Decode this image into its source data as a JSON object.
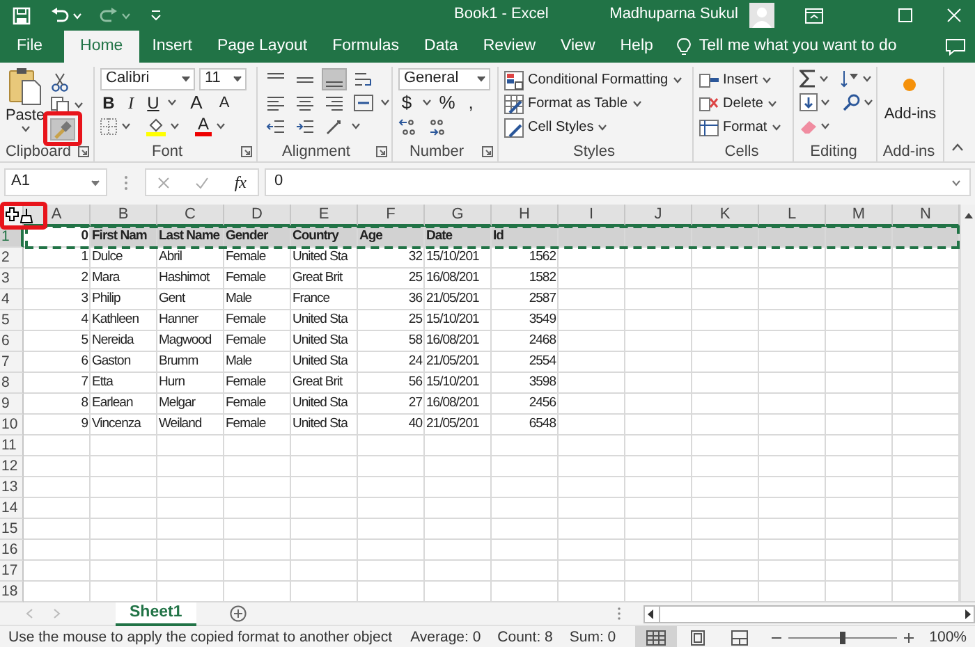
{
  "title_bar": {
    "title": "Book1 - Excel",
    "user": "Madhuparna Sukul"
  },
  "ribbon_tabs": [
    {
      "label": "File",
      "selected": false
    },
    {
      "label": "Home",
      "selected": true
    },
    {
      "label": "Insert",
      "selected": false
    },
    {
      "label": "Page Layout",
      "selected": false
    },
    {
      "label": "Formulas",
      "selected": false
    },
    {
      "label": "Data",
      "selected": false
    },
    {
      "label": "Review",
      "selected": false
    },
    {
      "label": "View",
      "selected": false
    },
    {
      "label": "Help",
      "selected": false
    }
  ],
  "tell_me": "Tell me what you want to do",
  "ribbon_groups": [
    {
      "kind": "clipboard",
      "label": "Clipboard",
      "paste": "Paste",
      "format_painter": {
        "pressed": true,
        "highlighted": true
      }
    },
    {
      "kind": "font",
      "label": "Font",
      "font": "Calibri",
      "size": "11",
      "style_buttons": [
        {
          "kind": "bold",
          "label": "B"
        },
        {
          "kind": "italic",
          "label": "I"
        },
        {
          "kind": "underline",
          "label": "U"
        }
      ],
      "size_buttons": [
        {
          "kind": "grow",
          "label": "A"
        },
        {
          "kind": "shrink",
          "label": "A"
        }
      ],
      "font_color_label": "A"
    },
    {
      "kind": "alignment",
      "label": "Alignment",
      "bottom_align": {
        "pressed": true
      }
    },
    {
      "kind": "number",
      "label": "Number",
      "format": "General",
      "symbols": [
        "$",
        "%",
        ","
      ]
    },
    {
      "kind": "styles",
      "label": "Styles",
      "commands": [
        {
          "kind": "conditional",
          "label": "Conditional Formatting"
        },
        {
          "kind": "table",
          "label": "Format as Table"
        },
        {
          "kind": "cellstyles",
          "label": "Cell Styles"
        }
      ]
    },
    {
      "kind": "cells",
      "label": "Cells",
      "commands": [
        {
          "kind": "insert",
          "label": "Insert"
        },
        {
          "kind": "delete",
          "label": "Delete"
        },
        {
          "kind": "format",
          "label": "Format"
        }
      ]
    },
    {
      "kind": "editing",
      "label": "Editing"
    },
    {
      "kind": "addins",
      "label": "Add-ins",
      "button": "Add-ins"
    }
  ],
  "formula_bar": {
    "name_box": "A1",
    "function_label": "fx",
    "formula": "0"
  },
  "grid": {
    "cursor": {
      "kind": "format_painter",
      "highlighted": true
    },
    "columns": [
      {
        "letter": "A",
        "selected": true,
        "active": true
      },
      {
        "letter": "B",
        "selected": true,
        "active": false
      },
      {
        "letter": "C",
        "selected": true,
        "active": false
      },
      {
        "letter": "D",
        "selected": true,
        "active": false
      },
      {
        "letter": "E",
        "selected": true,
        "active": false
      },
      {
        "letter": "F",
        "selected": true,
        "active": false
      },
      {
        "letter": "G",
        "selected": true,
        "active": false
      },
      {
        "letter": "H",
        "selected": true,
        "active": false
      },
      {
        "letter": "I",
        "selected": true,
        "active": false
      },
      {
        "letter": "J",
        "selected": true,
        "active": false
      },
      {
        "letter": "K",
        "selected": true,
        "active": false
      },
      {
        "letter": "L",
        "selected": true,
        "active": false
      },
      {
        "letter": "M",
        "selected": true,
        "active": false
      },
      {
        "letter": "N",
        "selected": true,
        "active": false
      }
    ],
    "rows": [
      {
        "header": "1",
        "selected": true,
        "bold": true,
        "copied": true,
        "cells": [
          "0",
          "First Nam",
          "Last Name",
          "Gender",
          "Country",
          "Age",
          "Date",
          "Id"
        ]
      },
      {
        "header": "2",
        "selected": false,
        "bold": false,
        "copied": false,
        "cells": [
          "1",
          "Dulce",
          "Abril",
          "Female",
          "United Sta",
          "32",
          "15/10/201",
          "1562"
        ]
      },
      {
        "header": "3",
        "selected": false,
        "bold": false,
        "copied": false,
        "cells": [
          "2",
          "Mara",
          "Hashimot",
          "Female",
          "Great Brit",
          "25",
          "16/08/201",
          "1582"
        ]
      },
      {
        "header": "4",
        "selected": false,
        "bold": false,
        "copied": false,
        "cells": [
          "3",
          "Philip",
          "Gent",
          "Male",
          "France",
          "36",
          "21/05/201",
          "2587"
        ]
      },
      {
        "header": "5",
        "selected": false,
        "bold": false,
        "copied": false,
        "cells": [
          "4",
          "Kathleen",
          "Hanner",
          "Female",
          "United Sta",
          "25",
          "15/10/201",
          "3549"
        ]
      },
      {
        "header": "6",
        "selected": false,
        "bold": false,
        "copied": false,
        "cells": [
          "5",
          "Nereida",
          "Magwood",
          "Female",
          "United Sta",
          "58",
          "16/08/201",
          "2468"
        ]
      },
      {
        "header": "7",
        "selected": false,
        "bold": false,
        "copied": false,
        "cells": [
          "6",
          "Gaston",
          "Brumm",
          "Male",
          "United Sta",
          "24",
          "21/05/201",
          "2554"
        ]
      },
      {
        "header": "8",
        "selected": false,
        "bold": false,
        "copied": false,
        "cells": [
          "7",
          "Etta",
          "Hurn",
          "Female",
          "Great Brit",
          "56",
          "15/10/201",
          "3598"
        ]
      },
      {
        "header": "9",
        "selected": false,
        "bold": false,
        "copied": false,
        "cells": [
          "8",
          "Earlean",
          "Melgar",
          "Female",
          "United Sta",
          "27",
          "16/08/201",
          "2456"
        ]
      },
      {
        "header": "10",
        "selected": false,
        "bold": false,
        "copied": false,
        "cells": [
          "9",
          "Vincenza",
          "Weiland",
          "Female",
          "United Sta",
          "40",
          "21/05/201",
          "6548"
        ]
      },
      {
        "header": "11",
        "selected": false
      },
      {
        "header": "12",
        "selected": false
      },
      {
        "header": "13",
        "selected": false
      },
      {
        "header": "14",
        "selected": false
      },
      {
        "header": "15",
        "selected": false
      },
      {
        "header": "16",
        "selected": false
      },
      {
        "header": "17",
        "selected": false
      },
      {
        "header": "18",
        "selected": false
      }
    ]
  },
  "sheet_tabs": [
    {
      "label": "Sheet1",
      "selected": true
    }
  ],
  "status_bar": {
    "message": "Use the mouse to apply the copied format to another object",
    "stats": [
      "Average: 0",
      "Count: 8",
      "Sum: 0"
    ],
    "views": [
      {
        "kind": "normal",
        "selected": true
      },
      {
        "kind": "page_layout",
        "selected": false
      },
      {
        "kind": "page_break",
        "selected": false
      }
    ],
    "zoom": {
      "level": 0.5,
      "label": "100%"
    }
  }
}
